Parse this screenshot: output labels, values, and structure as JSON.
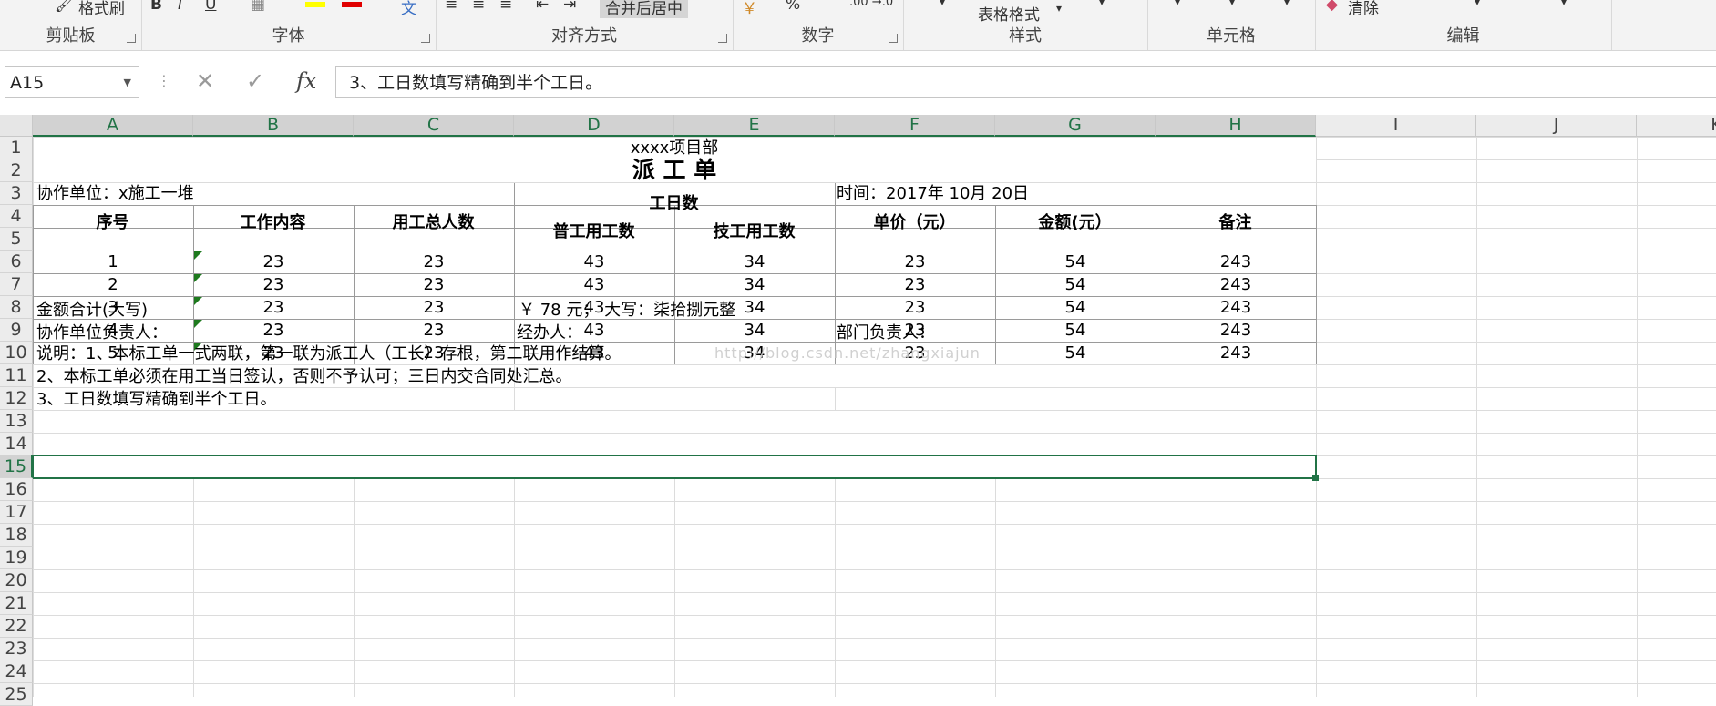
{
  "ribbon": {
    "groups": [
      {
        "label": "剪贴板"
      },
      {
        "label": "字体"
      },
      {
        "label": "对齐方式"
      },
      {
        "label": "数字"
      },
      {
        "label": "样式"
      },
      {
        "label": "单元格"
      },
      {
        "label": "编辑"
      }
    ],
    "format_painter_label": "格式刷",
    "merge_center_label": "合并后居中",
    "table_format_label": "表格格式",
    "clear_label": "清除",
    "percent_label": "%"
  },
  "formula_bar": {
    "name_box": "A15",
    "fx_label": "fx",
    "content": "3、工日数填写精确到半个工日。"
  },
  "columns": [
    "A",
    "B",
    "C",
    "D",
    "E",
    "F",
    "G",
    "H",
    "I",
    "J",
    "K"
  ],
  "rows": [
    "1",
    "2",
    "3",
    "4",
    "5",
    "6",
    "7",
    "8",
    "9",
    "10",
    "11",
    "12",
    "13",
    "14",
    "15",
    "16",
    "17",
    "18",
    "19",
    "20",
    "21",
    "22",
    "23",
    "24",
    "25"
  ],
  "sheet": {
    "project": "xxxx项目部",
    "title": "派 工 单",
    "unit": "协作单位：x施工一堆",
    "time": "时间：2017年 10月 20日",
    "headers": {
      "seq": "序号",
      "content": "工作内容",
      "total": "用工总人数",
      "days": "工日数",
      "general": "普工用工数",
      "skilled": "技工用工数",
      "price": "单价（元）",
      "amount": "金额(元）",
      "remark": "备注"
    },
    "data_rows": [
      [
        "1",
        "23",
        "23",
        "43",
        "34",
        "23",
        "54",
        "243"
      ],
      [
        "2",
        "23",
        "23",
        "43",
        "34",
        "23",
        "54",
        "243"
      ],
      [
        "3",
        "23",
        "23",
        "43",
        "34",
        "23",
        "54",
        "243"
      ],
      [
        "4",
        "23",
        "23",
        "43",
        "34",
        "23",
        "54",
        "243"
      ],
      [
        "5",
        "23",
        "23",
        "43",
        "34",
        "23",
        "54",
        "243"
      ]
    ],
    "total_label": "金额合计(大写)",
    "total_value": "￥ 78 元； 大写：柒拾捌元整",
    "unit_leader": "协作单位负责人：",
    "handler": "经办人：",
    "dept_leader": "部门负责人：",
    "note1": "说明：1、本标工单一式两联，第一联为派工人（工长）存根，第二联用作结算。",
    "note2": "2、本标工单必须在用工当日签认，否则不予认可；三日内交合同处汇总。",
    "note3": "3、工日数填写精确到半个工日。"
  },
  "watermark": "http://blog.csdn.net/zhangxiajun",
  "colors": {
    "selection": "#217346",
    "error_indicator": "#1e7a1e",
    "header_bg": "#e6e6e6"
  }
}
